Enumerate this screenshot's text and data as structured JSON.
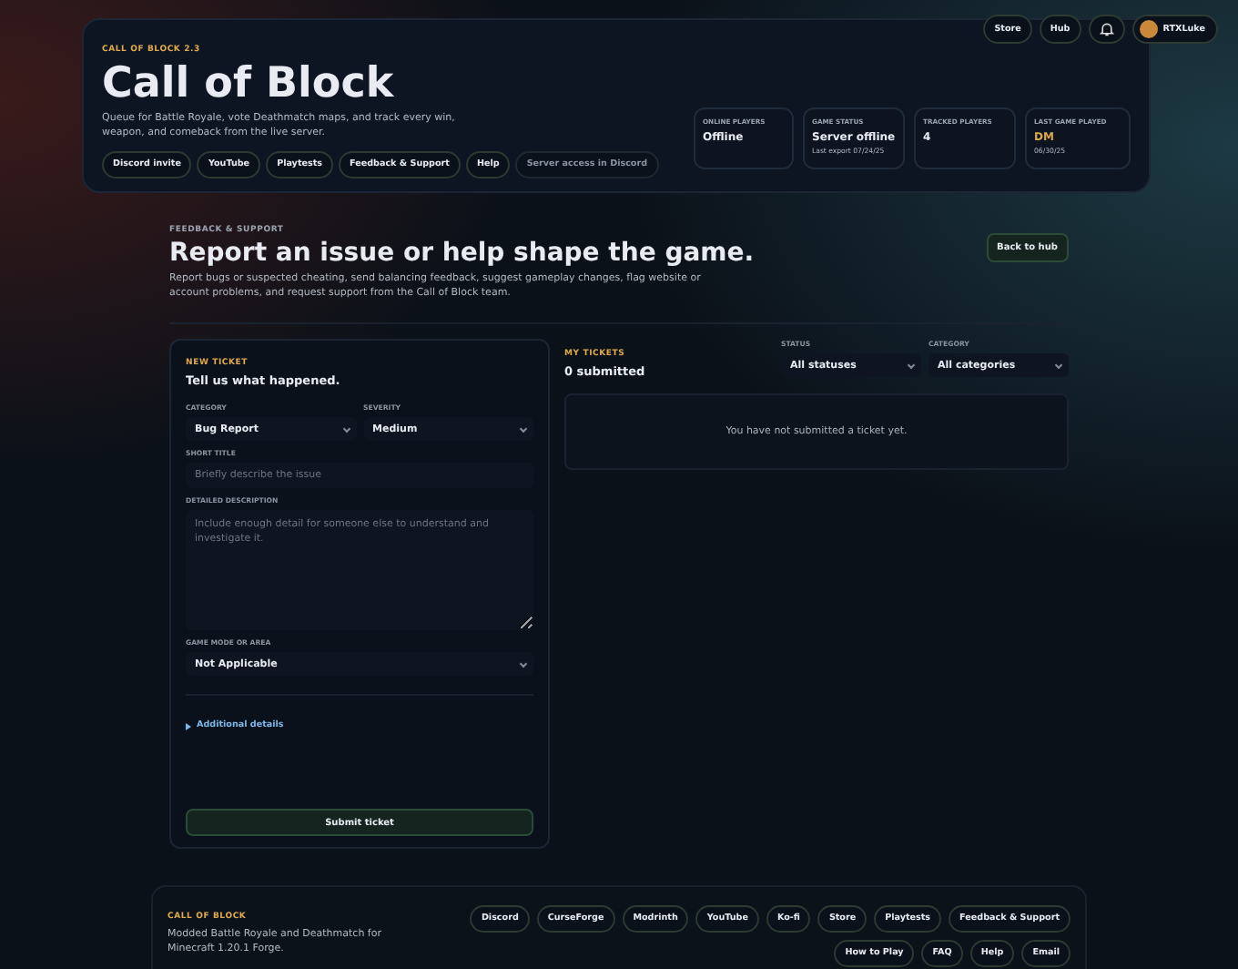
{
  "nav": {
    "links": [
      "Store",
      "Hub"
    ],
    "user": "RTXLuke"
  },
  "hero": {
    "eyebrow": "CALL OF BLOCK 2.3",
    "title": "Call of Block",
    "description": "Queue for Battle Royale, vote Deathmatch maps, and track every win, weapon, and comeback from the live server.",
    "links": [
      {
        "label": "Discord invite",
        "disabled": false
      },
      {
        "label": "YouTube",
        "disabled": false
      },
      {
        "label": "Playtests",
        "disabled": false
      },
      {
        "label": "Feedback & Support",
        "disabled": false
      },
      {
        "label": "Help",
        "disabled": false
      },
      {
        "label": "Server access in Discord",
        "disabled": true
      }
    ],
    "stats": [
      {
        "label": "ONLINE PLAYERS",
        "value": "Offline",
        "highlight": false
      },
      {
        "label": "GAME STATUS",
        "value": "Server offline",
        "highlight": false,
        "sub": "Last export 07/24/25"
      },
      {
        "label": "TRACKED PLAYERS",
        "value": "4",
        "highlight": false
      },
      {
        "label": "LAST GAME PLAYED",
        "value": "DM",
        "highlight": true,
        "sub": "06/30/25"
      }
    ]
  },
  "section": {
    "eyebrow": "FEEDBACK & SUPPORT",
    "title": "Report an issue or help shape the game.",
    "description": "Report bugs or suspected cheating, send balancing feedback, suggest gameplay changes, flag website or account problems, and request support from the Call of Block team.",
    "back": "Back to hub"
  },
  "form": {
    "eyebrow": "NEW TICKET",
    "title": "Tell us what happened.",
    "category": {
      "label": "CATEGORY",
      "value": "Bug Report"
    },
    "severity": {
      "label": "SEVERITY",
      "value": "Medium"
    },
    "short_title": {
      "label": "SHORT TITLE",
      "placeholder": "Briefly describe the issue"
    },
    "description": {
      "label": "DETAILED DESCRIPTION",
      "placeholder": "Include enough detail for someone else to understand and investigate it."
    },
    "mode": {
      "label": "GAME MODE OR AREA",
      "value": "Not Applicable"
    },
    "details": {
      "label": "Additional details",
      "expanded": false
    },
    "submit": "Submit ticket"
  },
  "tickets": {
    "eyebrow": "MY TICKETS",
    "count": "0 submitted",
    "status": {
      "label": "STATUS",
      "value": "All statuses"
    },
    "category": {
      "label": "CATEGORY",
      "value": "All categories"
    },
    "empty": "You have not submitted a ticket yet."
  },
  "footer": {
    "eyebrow": "CALL OF BLOCK",
    "description": "Modded Battle Royale and Deathmatch for Minecraft 1.20.1 Forge.",
    "links": [
      "Discord",
      "CurseForge",
      "Modrinth",
      "YouTube",
      "Ko-fi",
      "Store",
      "Playtests",
      "Feedback & Support",
      "How to Play",
      "FAQ",
      "Help",
      "Email"
    ]
  }
}
